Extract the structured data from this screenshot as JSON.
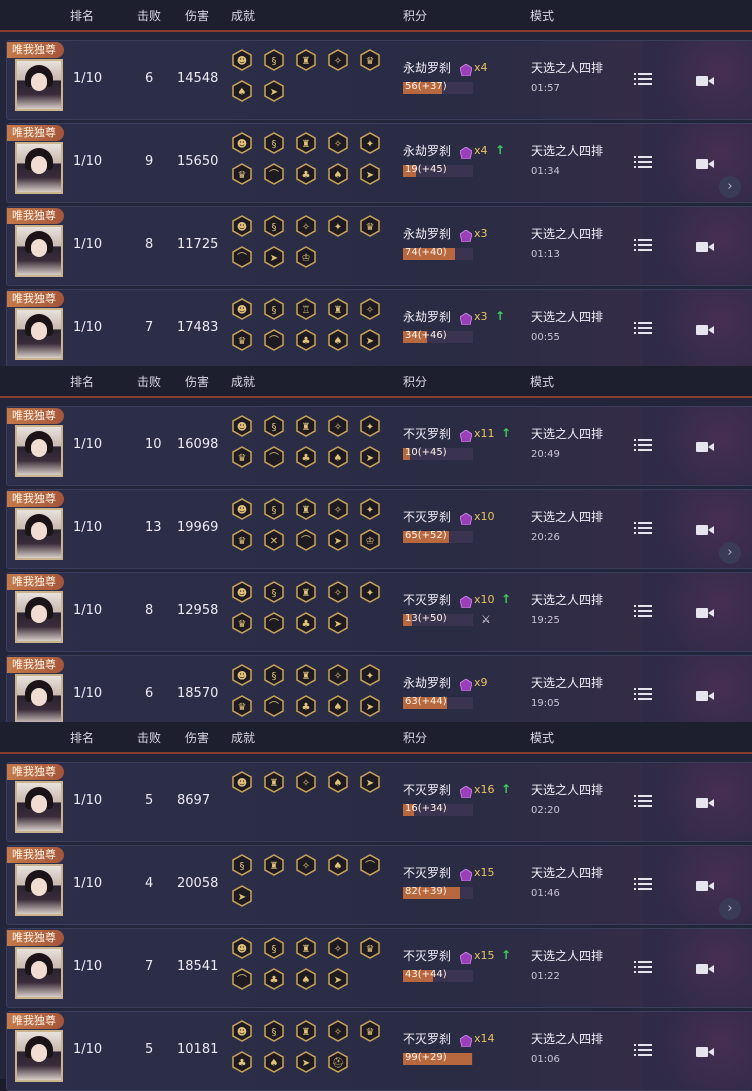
{
  "headers": {
    "rank": "排名",
    "kills": "击败",
    "damage": "伤害",
    "achievements": "成就",
    "score": "积分",
    "mode": "模式"
  },
  "badge_text": "唯我独尊",
  "sections": [
    {
      "rows": [
        {
          "rank": "1/10",
          "kills": "6",
          "damage": "14548",
          "ach": [
            "mask",
            "serpent",
            "banner",
            "claw",
            "shield",
            "pouch",
            "flag"
          ],
          "title": "永劫罗刹",
          "mult": "x4",
          "up": false,
          "bar": "56(+37)",
          "fill": 0.56,
          "mode": "天选之人四排",
          "time": "01:57",
          "chev": false,
          "x": false
        },
        {
          "rank": "1/10",
          "kills": "9",
          "damage": "15650",
          "ach": [
            "mask",
            "serpent",
            "banner",
            "claw",
            "sword",
            "shield",
            "bow",
            "clover",
            "pouch",
            "flag"
          ],
          "title": "永劫罗刹",
          "mult": "x4",
          "up": true,
          "bar": "19(+45)",
          "fill": 0.19,
          "mode": "天选之人四排",
          "time": "01:34",
          "chev": true,
          "x": false
        },
        {
          "rank": "1/10",
          "kills": "8",
          "damage": "11725",
          "ach": [
            "mask",
            "serpent",
            "claw",
            "sword",
            "shield",
            "bow",
            "flag",
            "crown"
          ],
          "title": "永劫罗刹",
          "mult": "x3",
          "up": false,
          "bar": "74(+40)",
          "fill": 0.74,
          "mode": "天选之人四排",
          "time": "01:13",
          "chev": false,
          "x": false
        },
        {
          "rank": "1/10",
          "kills": "7",
          "damage": "17483",
          "ach": [
            "mask",
            "serpent",
            "tower",
            "banner",
            "claw",
            "shield",
            "bow",
            "clover",
            "pouch",
            "flag"
          ],
          "title": "永劫罗刹",
          "mult": "x3",
          "up": true,
          "bar": "34(+46)",
          "fill": 0.34,
          "mode": "天选之人四排",
          "time": "00:55",
          "chev": false,
          "x": false
        }
      ]
    },
    {
      "rows": [
        {
          "rank": "1/10",
          "kills": "10",
          "damage": "16098",
          "ach": [
            "mask",
            "serpent",
            "banner",
            "claw",
            "sword",
            "shield",
            "bow",
            "clover",
            "pouch",
            "flag"
          ],
          "title": "不灭罗刹",
          "mult": "x11",
          "up": true,
          "bar": "10(+45)",
          "fill": 0.1,
          "mode": "天选之人四排",
          "time": "20:49",
          "chev": false,
          "x": false
        },
        {
          "rank": "1/10",
          "kills": "13",
          "damage": "19969",
          "ach": [
            "mask",
            "serpent",
            "banner",
            "claw",
            "sword",
            "shield",
            "cross",
            "bow",
            "flag",
            "crown"
          ],
          "title": "不灭罗刹",
          "mult": "x10",
          "up": false,
          "bar": "65(+52)",
          "fill": 0.65,
          "mode": "天选之人四排",
          "time": "20:26",
          "chev": true,
          "x": false
        },
        {
          "rank": "1/10",
          "kills": "8",
          "damage": "12958",
          "ach": [
            "mask",
            "serpent",
            "banner",
            "claw",
            "sword",
            "shield",
            "bow",
            "clover",
            "flag"
          ],
          "title": "不灭罗刹",
          "mult": "x10",
          "up": true,
          "bar": "13(+50)",
          "fill": 0.13,
          "mode": "天选之人四排",
          "time": "19:25",
          "chev": false,
          "x": true
        },
        {
          "rank": "1/10",
          "kills": "6",
          "damage": "18570",
          "ach": [
            "mask",
            "serpent",
            "banner",
            "claw",
            "sword",
            "shield",
            "bow",
            "clover",
            "pouch",
            "flag"
          ],
          "title": "永劫罗刹",
          "mult": "x9",
          "up": false,
          "bar": "63(+44)",
          "fill": 0.63,
          "mode": "天选之人四排",
          "time": "19:05",
          "chev": false,
          "x": false
        }
      ]
    },
    {
      "rows": [
        {
          "rank": "1/10",
          "kills": "5",
          "damage": "8697",
          "ach": [
            "mask",
            "banner",
            "claw",
            "pouch",
            "flag"
          ],
          "title": "不灭罗刹",
          "mult": "x16",
          "up": true,
          "bar": "16(+34)",
          "fill": 0.16,
          "mode": "天选之人四排",
          "time": "02:20",
          "chev": false,
          "x": false
        },
        {
          "rank": "1/10",
          "kills": "4",
          "damage": "20058",
          "ach": [
            "serpent",
            "banner",
            "claw",
            "pouch",
            "bow",
            "flag"
          ],
          "title": "不灭罗刹",
          "mult": "x15",
          "up": false,
          "bar": "82(+39)",
          "fill": 0.82,
          "mode": "天选之人四排",
          "time": "01:46",
          "chev": true,
          "x": false
        },
        {
          "rank": "1/10",
          "kills": "7",
          "damage": "18541",
          "ach": [
            "mask",
            "serpent",
            "banner",
            "claw",
            "shield",
            "bow",
            "clover",
            "pouch",
            "flag"
          ],
          "title": "不灭罗刹",
          "mult": "x15",
          "up": true,
          "bar": "43(+44)",
          "fill": 0.43,
          "mode": "天选之人四排",
          "time": "01:22",
          "chev": false,
          "x": false
        },
        {
          "rank": "1/10",
          "kills": "5",
          "damage": "10181",
          "ach": [
            "mask",
            "serpent",
            "banner",
            "claw",
            "shield",
            "clover",
            "pouch",
            "flag",
            "helm"
          ],
          "title": "不灭罗刹",
          "mult": "x14",
          "up": false,
          "bar": "99(+29)",
          "fill": 0.99,
          "mode": "天选之人四排",
          "time": "01:06",
          "chev": false,
          "x": false
        }
      ]
    }
  ],
  "colors": {
    "accent": "#b8683e",
    "gold": "#c9a55a",
    "up": "#3ccf5a",
    "gem": "#9b3fb8"
  }
}
